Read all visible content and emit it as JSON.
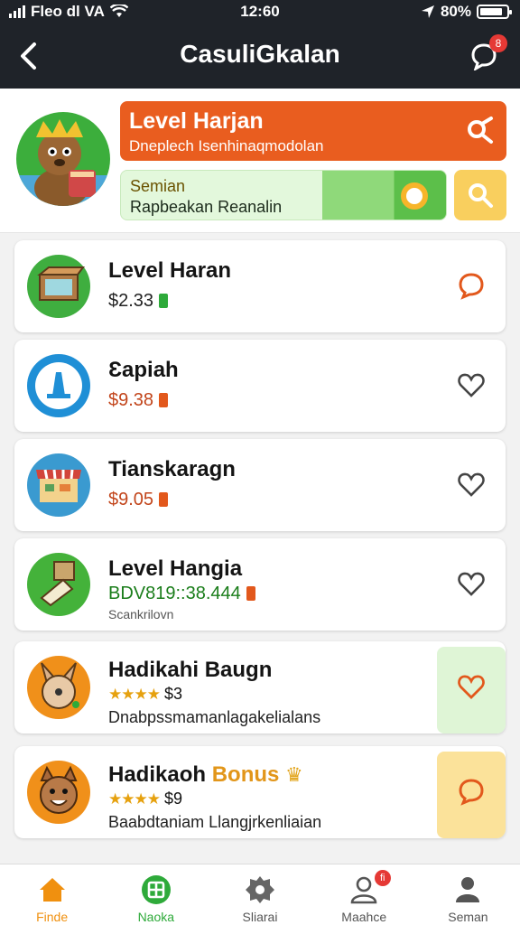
{
  "status_bar": {
    "carrier": "Fleo dl VA",
    "time": "12:60",
    "battery": "80%"
  },
  "header": {
    "title": "CasuliGkalan",
    "notification_count": "8"
  },
  "hero": {
    "orange_title": "Level Harjan",
    "orange_subtitle": "Dneplech Isenhinaqmodolan",
    "green_title": "Semian",
    "green_subtitle": "Rapbeakan Reanalin"
  },
  "items": [
    {
      "title": "Level Haran",
      "price": "$2.33",
      "price_color": "#222222",
      "tag_color": "#2eaa3a",
      "icon": "box-icon",
      "heart_color": "#e2581c"
    },
    {
      "title": "Ɛapiah",
      "price": "$9.38",
      "price_color": "#c2451b",
      "tag_color": "#e2581c",
      "icon": "a-letter-icon",
      "heart_color": "#444444"
    },
    {
      "title": "Tianskaragn",
      "price": "$9.05",
      "price_color": "#c2451b",
      "tag_color": "#e2581c",
      "icon": "shop-icon",
      "heart_color": "#444444"
    },
    {
      "title": "Level Hangia",
      "price": "BDV819::38.444",
      "price_color": "#1a7d1a",
      "tag_color": "#e2581c",
      "subtitle": "Scankrilovn",
      "icon": "parcel-icon",
      "heart_color": "#444444"
    },
    {
      "title": "Hadikahi Baugn",
      "rating": "★★★★",
      "price": "$3",
      "subtitle": "Dnabpssmamanlagakelialans",
      "icon": "rabbit-icon",
      "heart_color": "#e2581c",
      "side_color": "#dff5d6"
    },
    {
      "title": "Hadikaoh",
      "bonus": "Bonus",
      "rating": "★★★★",
      "price": "$9",
      "subtitle": "Baabdtaniam Llangjrkenliaian",
      "icon": "dog-icon",
      "heart_color": "#e2581c",
      "side_color": "#fbe29a"
    }
  ],
  "tabs": [
    {
      "label": "Finde",
      "icon": "home-icon",
      "color": "#f0900f"
    },
    {
      "label": "Naoka",
      "icon": "grid-icon",
      "color": "#2eaa3a"
    },
    {
      "label": "Sliarai",
      "icon": "gear-icon",
      "color": "#555555"
    },
    {
      "label": "Maahce",
      "icon": "person-icon",
      "badge": "fi",
      "color": "#555555"
    },
    {
      "label": "Seman",
      "icon": "profile-icon",
      "color": "#555555"
    }
  ]
}
